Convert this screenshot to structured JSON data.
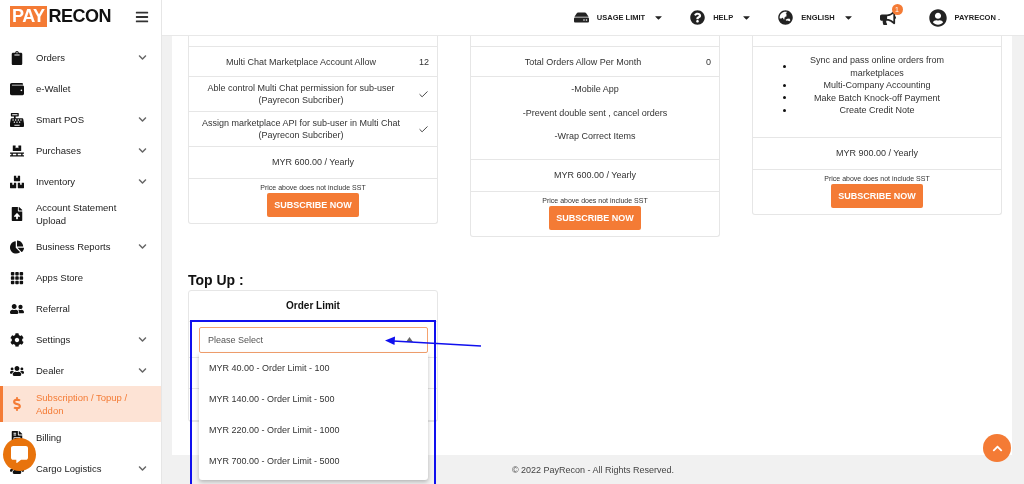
{
  "brand": {
    "part_1": "PAY",
    "part_2": "RECON"
  },
  "sidebar": {
    "items": [
      {
        "label": "Orders",
        "has_submenu": true,
        "selected": false
      },
      {
        "label": "e-Wallet",
        "has_submenu": false,
        "selected": false
      },
      {
        "label": "Smart POS",
        "has_submenu": true,
        "selected": false
      },
      {
        "label": "Purchases",
        "has_submenu": true,
        "selected": false
      },
      {
        "label": "Inventory",
        "has_submenu": true,
        "selected": false
      },
      {
        "label": "Account Statement Upload",
        "has_submenu": false,
        "selected": false
      },
      {
        "label": "Business Reports",
        "has_submenu": true,
        "selected": false
      },
      {
        "label": "Apps Store",
        "has_submenu": false,
        "selected": false
      },
      {
        "label": "Referral",
        "has_submenu": false,
        "selected": false
      },
      {
        "label": "Settings",
        "has_submenu": true,
        "selected": false
      },
      {
        "label": "Dealer",
        "has_submenu": true,
        "selected": false
      },
      {
        "label": "Subscription / Topup / Addon",
        "has_submenu": false,
        "selected": true
      },
      {
        "label": "Billing",
        "has_submenu": false,
        "selected": false
      },
      {
        "label": "Cargo Logistics",
        "has_submenu": true,
        "selected": false
      }
    ]
  },
  "header": {
    "items": [
      {
        "kind": "dropdown",
        "label": "USAGE LIMIT"
      },
      {
        "kind": "dropdown",
        "label": "HELP"
      },
      {
        "kind": "dropdown",
        "label": "ENGLISH"
      },
      {
        "kind": "notifications",
        "badge": "1"
      },
      {
        "kind": "user",
        "label": "PAYRECON ."
      }
    ]
  },
  "plans": [
    {
      "rows": [
        {
          "kind": "feature",
          "label": "Multi Chat Marketplace Account Allow",
          "value": "12"
        },
        {
          "kind": "feature",
          "label": "Able control Multi Chat permission for sub-user (Payrecon Subcriber)",
          "checked": true
        },
        {
          "kind": "feature",
          "label": "Assign marketplace API for sub-user in Multi Chat (Payrecon Subcriber)",
          "checked": true
        },
        {
          "kind": "price",
          "text": "MYR 600.00 / Yearly"
        },
        {
          "kind": "footer",
          "note": "Price above does not include SST",
          "button": "SUBSCRIBE NOW"
        }
      ]
    },
    {
      "rows": [
        {
          "kind": "feature",
          "label": "Total Orders Allow Per Month",
          "value": "0"
        },
        {
          "kind": "list",
          "bulleted": false,
          "items": [
            "-Mobile App",
            "-Prevent double sent , cancel orders",
            "-Wrap Correct Items"
          ]
        },
        {
          "kind": "price",
          "text": "MYR 600.00 / Yearly"
        },
        {
          "kind": "footer",
          "note": "Price above does not include SST",
          "button": "SUBSCRIBE NOW"
        }
      ]
    },
    {
      "rows": [
        {
          "kind": "list",
          "bulleted": true,
          "items": [
            "Sync and pass online orders from marketplaces",
            "Multi-Company Accounting",
            "Make Batch Knock-off Payment",
            "Create Credit Note"
          ]
        },
        {
          "kind": "price",
          "text": "MYR 900.00 / Yearly"
        },
        {
          "kind": "footer",
          "note": "Price above does not include SST",
          "button": "SUBSCRIBE NOW"
        }
      ]
    }
  ],
  "top_up": {
    "title": "Top Up :",
    "card_title": "Order Limit",
    "select": {
      "placeholder": "Please Select",
      "expanded": true,
      "options": [
        {
          "label": "MYR 40.00 - Order Limit - 100",
          "selected": false
        },
        {
          "label": "MYR 140.00 - Order Limit - 500",
          "selected": false
        },
        {
          "label": "MYR 220.00 - Order Limit - 1000",
          "selected": false
        },
        {
          "label": "MYR 700.00 - Order Limit - 5000",
          "selected": false
        }
      ]
    }
  },
  "footer": {
    "copyright": "© 2022 PayRecon - All Rights Reserved."
  }
}
